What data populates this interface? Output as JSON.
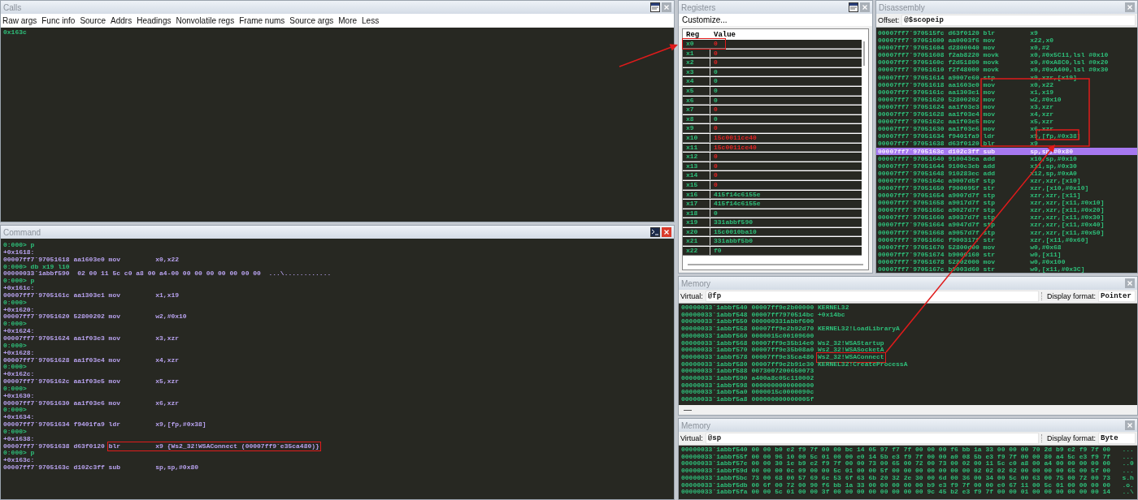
{
  "calls": {
    "title": "Calls",
    "toolbar": [
      "Raw args",
      "Func info",
      "Source",
      "Addrs",
      "Headings",
      "Nonvolatile regs",
      "Frame nums",
      "Source args",
      "More",
      "Less"
    ],
    "lines": [
      "0x163c"
    ]
  },
  "command": {
    "title": "Command",
    "focused": true,
    "lines": [
      {
        "kind": "prompt",
        "text": "0:000> p"
      },
      {
        "kind": "output",
        "text": "+0x1618:"
      },
      {
        "kind": "output",
        "text": "00007ff7`97051618 aa1603e0 mov         x0,x22"
      },
      {
        "kind": "prompt",
        "text": "0:000> db x19 l10"
      },
      {
        "kind": "output",
        "text": "00000033`1abbf590  02 00 11 5c c0 a8 00 a4-00 00 00 00 00 00 00 00  ...\\............"
      },
      {
        "kind": "prompt",
        "text": "0:000> p"
      },
      {
        "kind": "output",
        "text": "+0x161c:"
      },
      {
        "kind": "output",
        "text": "00007ff7`9705161c aa1303e1 mov         x1,x19"
      },
      {
        "kind": "prompt",
        "text": "0:000>"
      },
      {
        "kind": "output",
        "text": "+0x1620:"
      },
      {
        "kind": "output",
        "text": "00007ff7`97051620 52800202 mov         w2,#0x10"
      },
      {
        "kind": "prompt",
        "text": "0:000>"
      },
      {
        "kind": "output",
        "text": "+0x1624:"
      },
      {
        "kind": "output",
        "text": "00007ff7`97051624 aa1f03e3 mov         x3,xzr"
      },
      {
        "kind": "prompt",
        "text": "0:000>"
      },
      {
        "kind": "output",
        "text": "+0x1628:"
      },
      {
        "kind": "output",
        "text": "00007ff7`97051628 aa1f03e4 mov         x4,xzr"
      },
      {
        "kind": "prompt",
        "text": "0:000>"
      },
      {
        "kind": "output",
        "text": "+0x162c:"
      },
      {
        "kind": "output",
        "text": "00007ff7`9705162c aa1f03e5 mov         x5,xzr"
      },
      {
        "kind": "prompt",
        "text": "0:000>"
      },
      {
        "kind": "output",
        "text": "+0x1630:"
      },
      {
        "kind": "output",
        "text": "00007ff7`97051630 aa1f03e6 mov         x6,xzr"
      },
      {
        "kind": "prompt",
        "text": "0:000>"
      },
      {
        "kind": "output",
        "text": "+0x1634:"
      },
      {
        "kind": "output",
        "text": "00007ff7`97051634 f9401fa9 ldr         x9,[fp,#0x38]"
      },
      {
        "kind": "prompt",
        "text": "0:000>"
      },
      {
        "kind": "output",
        "text": "+0x1638:"
      },
      {
        "kind": "output",
        "text": "00007ff7`97051638 d63f0120",
        "boxed": "blr         x9 {Ws2_32!WSAConnect (00007ff9`e35ca480)}"
      },
      {
        "kind": "prompt",
        "text": "0:000> p"
      },
      {
        "kind": "output",
        "text": "+0x163c:"
      },
      {
        "kind": "output",
        "text": "00007ff7`9705163c d102c3ff sub         sp,sp,#0x80"
      }
    ]
  },
  "registers": {
    "title": "Registers",
    "customize": "Customize...",
    "columns": [
      "Reg",
      "Value"
    ],
    "rows": [
      {
        "reg": "x0",
        "value": "0",
        "changed": true,
        "highlighted": true
      },
      {
        "reg": "x1",
        "value": "0",
        "changed": true
      },
      {
        "reg": "x2",
        "value": "0",
        "changed": true
      },
      {
        "reg": "x3",
        "value": "0",
        "changed": false
      },
      {
        "reg": "x4",
        "value": "0",
        "changed": false
      },
      {
        "reg": "x5",
        "value": "0",
        "changed": false
      },
      {
        "reg": "x6",
        "value": "0",
        "changed": false
      },
      {
        "reg": "x7",
        "value": "0",
        "changed": true
      },
      {
        "reg": "x8",
        "value": "0",
        "changed": false
      },
      {
        "reg": "x9",
        "value": "0",
        "changed": true
      },
      {
        "reg": "x10",
        "value": "15c0011ce40",
        "changed": true
      },
      {
        "reg": "x11",
        "value": "15c0011ce40",
        "changed": true
      },
      {
        "reg": "x12",
        "value": "0",
        "changed": true
      },
      {
        "reg": "x13",
        "value": "0",
        "changed": true
      },
      {
        "reg": "x14",
        "value": "0",
        "changed": true
      },
      {
        "reg": "x15",
        "value": "0",
        "changed": true
      },
      {
        "reg": "x16",
        "value": "415f14c6155e",
        "changed": false
      },
      {
        "reg": "x17",
        "value": "415f14c6155e",
        "changed": false
      },
      {
        "reg": "x18",
        "value": "0",
        "changed": false
      },
      {
        "reg": "x19",
        "value": "331abbf590",
        "changed": false
      },
      {
        "reg": "x20",
        "value": "15c0010ba10",
        "changed": false
      },
      {
        "reg": "x21",
        "value": "331abbf5b0",
        "changed": false
      },
      {
        "reg": "x22",
        "value": "f0",
        "changed": false
      }
    ]
  },
  "disassembly": {
    "title": "Disassembly",
    "offset_label": "Offset:",
    "offset": "@$scopeip",
    "lines": [
      {
        "text": "00007ff7`970515fc d63f0120 blr         x9",
        "selected": false
      },
      {
        "text": "00007ff7`97051600 aa0003f6 mov         x22,x0",
        "selected": false
      },
      {
        "text": "00007ff7`97051604 d2800040 mov         x0,#2",
        "selected": false
      },
      {
        "text": "00007ff7`97051608 f2ab8220 movk        x0,#0x5C11,lsl #0x10",
        "selected": false
      },
      {
        "text": "00007ff7`9705160c f2d51800 movk        x0,#0xA8C0,lsl #0x20",
        "selected": false
      },
      {
        "text": "00007ff7`97051610 f2f48000 movk        x0,#0xA400,lsl #0x30",
        "selected": false
      },
      {
        "text": "00007ff7`97051614 a9007e60 stp         x0,xzr,[x19]",
        "selected": false
      },
      {
        "text": "00007ff7`97051618 aa1603e0 mov         x0,x22",
        "selected": false
      },
      {
        "text": "00007ff7`9705161c aa1303e1 mov         x1,x19",
        "selected": false
      },
      {
        "text": "00007ff7`97051620 52800202 mov         w2,#0x10",
        "selected": false
      },
      {
        "text": "00007ff7`97051624 aa1f03e3 mov         x3,xzr",
        "selected": false
      },
      {
        "text": "00007ff7`97051628 aa1f03e4 mov         x4,xzr",
        "selected": false
      },
      {
        "text": "00007ff7`9705162c aa1f03e5 mov         x5,xzr",
        "selected": false
      },
      {
        "text": "00007ff7`97051630 aa1f03e6 mov         x6,xzr",
        "selected": false
      },
      {
        "text": "00007ff7`97051634 f9401fa9 ldr         x9,[fp,#0x38]",
        "selected": false
      },
      {
        "text": "00007ff7`97051638 d63f0120 blr         x9",
        "selected": false
      },
      {
        "text": "00007ff7`9705163c d102c3ff sub         sp,sp,#0x80",
        "selected": true
      },
      {
        "text": "00007ff7`97051640 910043ea add         x10,sp,#0x10",
        "selected": false
      },
      {
        "text": "00007ff7`97051644 9100c3eb add         x11,sp,#0x30",
        "selected": false
      },
      {
        "text": "00007ff7`97051648 910283ec add         x12,sp,#0xA0",
        "selected": false
      },
      {
        "text": "00007ff7`9705164c a9007d5f stp         xzr,xzr,[x10]",
        "selected": false
      },
      {
        "text": "00007ff7`97051650 f900095f str         xzr,[x10,#0x10]",
        "selected": false
      },
      {
        "text": "00007ff7`97051654 a9007d7f stp         xzr,xzr,[x11]",
        "selected": false
      },
      {
        "text": "00007ff7`97051658 a9017d7f stp         xzr,xzr,[x11,#0x10]",
        "selected": false
      },
      {
        "text": "00007ff7`9705165c a9027d7f stp         xzr,xzr,[x11,#0x20]",
        "selected": false
      },
      {
        "text": "00007ff7`97051660 a9037d7f stp         xzr,xzr,[x11,#0x30]",
        "selected": false
      },
      {
        "text": "00007ff7`97051664 a9047d7f stp         xzr,xzr,[x11,#0x40]",
        "selected": false
      },
      {
        "text": "00007ff7`97051668 a9057d7f stp         xzr,xzr,[x11,#0x50]",
        "selected": false
      },
      {
        "text": "00007ff7`9705166c f900317f str         xzr,[x11,#0x60]",
        "selected": false
      },
      {
        "text": "00007ff7`97051670 52800d00 mov         w0,#0x68",
        "selected": false
      },
      {
        "text": "00007ff7`97051674 b9000160 str         w0,[x11]",
        "selected": false
      },
      {
        "text": "00007ff7`97051678 52802000 mov         w0,#0x100",
        "selected": false
      },
      {
        "text": "00007ff7`9705167c b9003d60 str         w0,[x11,#0x3C]",
        "selected": false
      }
    ]
  },
  "memory_panels": [
    {
      "title": "Memory",
      "virtual_label": "Virtual:",
      "virtual": "@fp",
      "format_label": "Display format:",
      "format": "Pointer",
      "lines": [
        "00000033`1abbf540 00007ff9e2b00000 KERNEL32",
        "00000033`1abbf548 00007ff7970514bc +0x14bc",
        "00000033`1abbf550 000000331abbf600",
        "00000033`1abbf558 00007ff9e2b92d70 KERNEL32!LoadLibraryA",
        "00000033`1abbf560 0000015c00109600",
        "00000033`1abbf568 00007ff9e35b14e0 Ws2_32!WSAStartup",
        "00000033`1abbf570 00007ff9e35b08a0 Ws2_32!WSASocketA",
        {
          "text": "00000033`1abbf578 00007ff9e35ca480",
          "boxed": "Ws2_32!WSAConnect"
        },
        "00000033`1abbf580 00007ff9e2b91e30 KERNEL32!CreateProcessA",
        "00000033`1abbf588 0073007200650073",
        "00000033`1abbf590 a400a8c05c110002",
        "00000033`1abbf598 0000000000000000",
        "00000033`1abbf5a0 0000015c0000090c",
        "00000033`1abbf5a8 000000000000005f"
      ]
    },
    {
      "title": "Memory",
      "virtual_label": "Virtual:",
      "virtual": "@sp",
      "format_label": "Display format:",
      "format": "Byte",
      "lines": [
        "00000033`1abbf540 00 00 b0 e2 f9 7f 00 00 bc 14 05 97 f7 7f 00 00 00 f6 bb 1a 33 00 00 00 70 2d b9 e2 f9 7f 00   ...",
        "00000033`1abbf55f 00 00 96 10 00 5c 01 00 00 e0 14 5b e3 f9 7f 00 00 a0 08 5b e3 f9 7f 00 00 80 a4 5c e3 f9 7f   ...",
        "00000033`1abbf57e 00 00 30 1e b9 e2 f9 7f 00 00 73 00 65 00 72 00 73 00 02 00 11 5c c0 a8 00 a4 00 00 00 00 00   ..0",
        "00000033`1abbf59d 00 00 00 0c 09 00 00 5c 01 00 00 5f 00 00 00 00 00 00 00 02 02 02 02 00 00 00 00 65 00 5f 00   ...",
        "00000033`1abbf5bc 73 00 68 00 57 69 6e 53 6f 63 6b 20 32 2e 30 00 6d 00 36 00 34 00 5c 00 63 00 75 00 72 00 73   s.h",
        "00000033`1abbf5db 00 6f 00 72 00 90 f6 bb 1a 33 00 00 00 00 00 b9 e3 f9 7f 00 00 e0 67 11 00 5c 01 00 00 00 00   .o.",
        "00000033`1abbf5fa 00 00 5c 01 00 00 3f 00 00 00 00 00 00 00 00 9c 45 b2 e3 f9 7f 00 00 01 00 00 00 00 00 00 14   ..\\"
      ]
    }
  ]
}
